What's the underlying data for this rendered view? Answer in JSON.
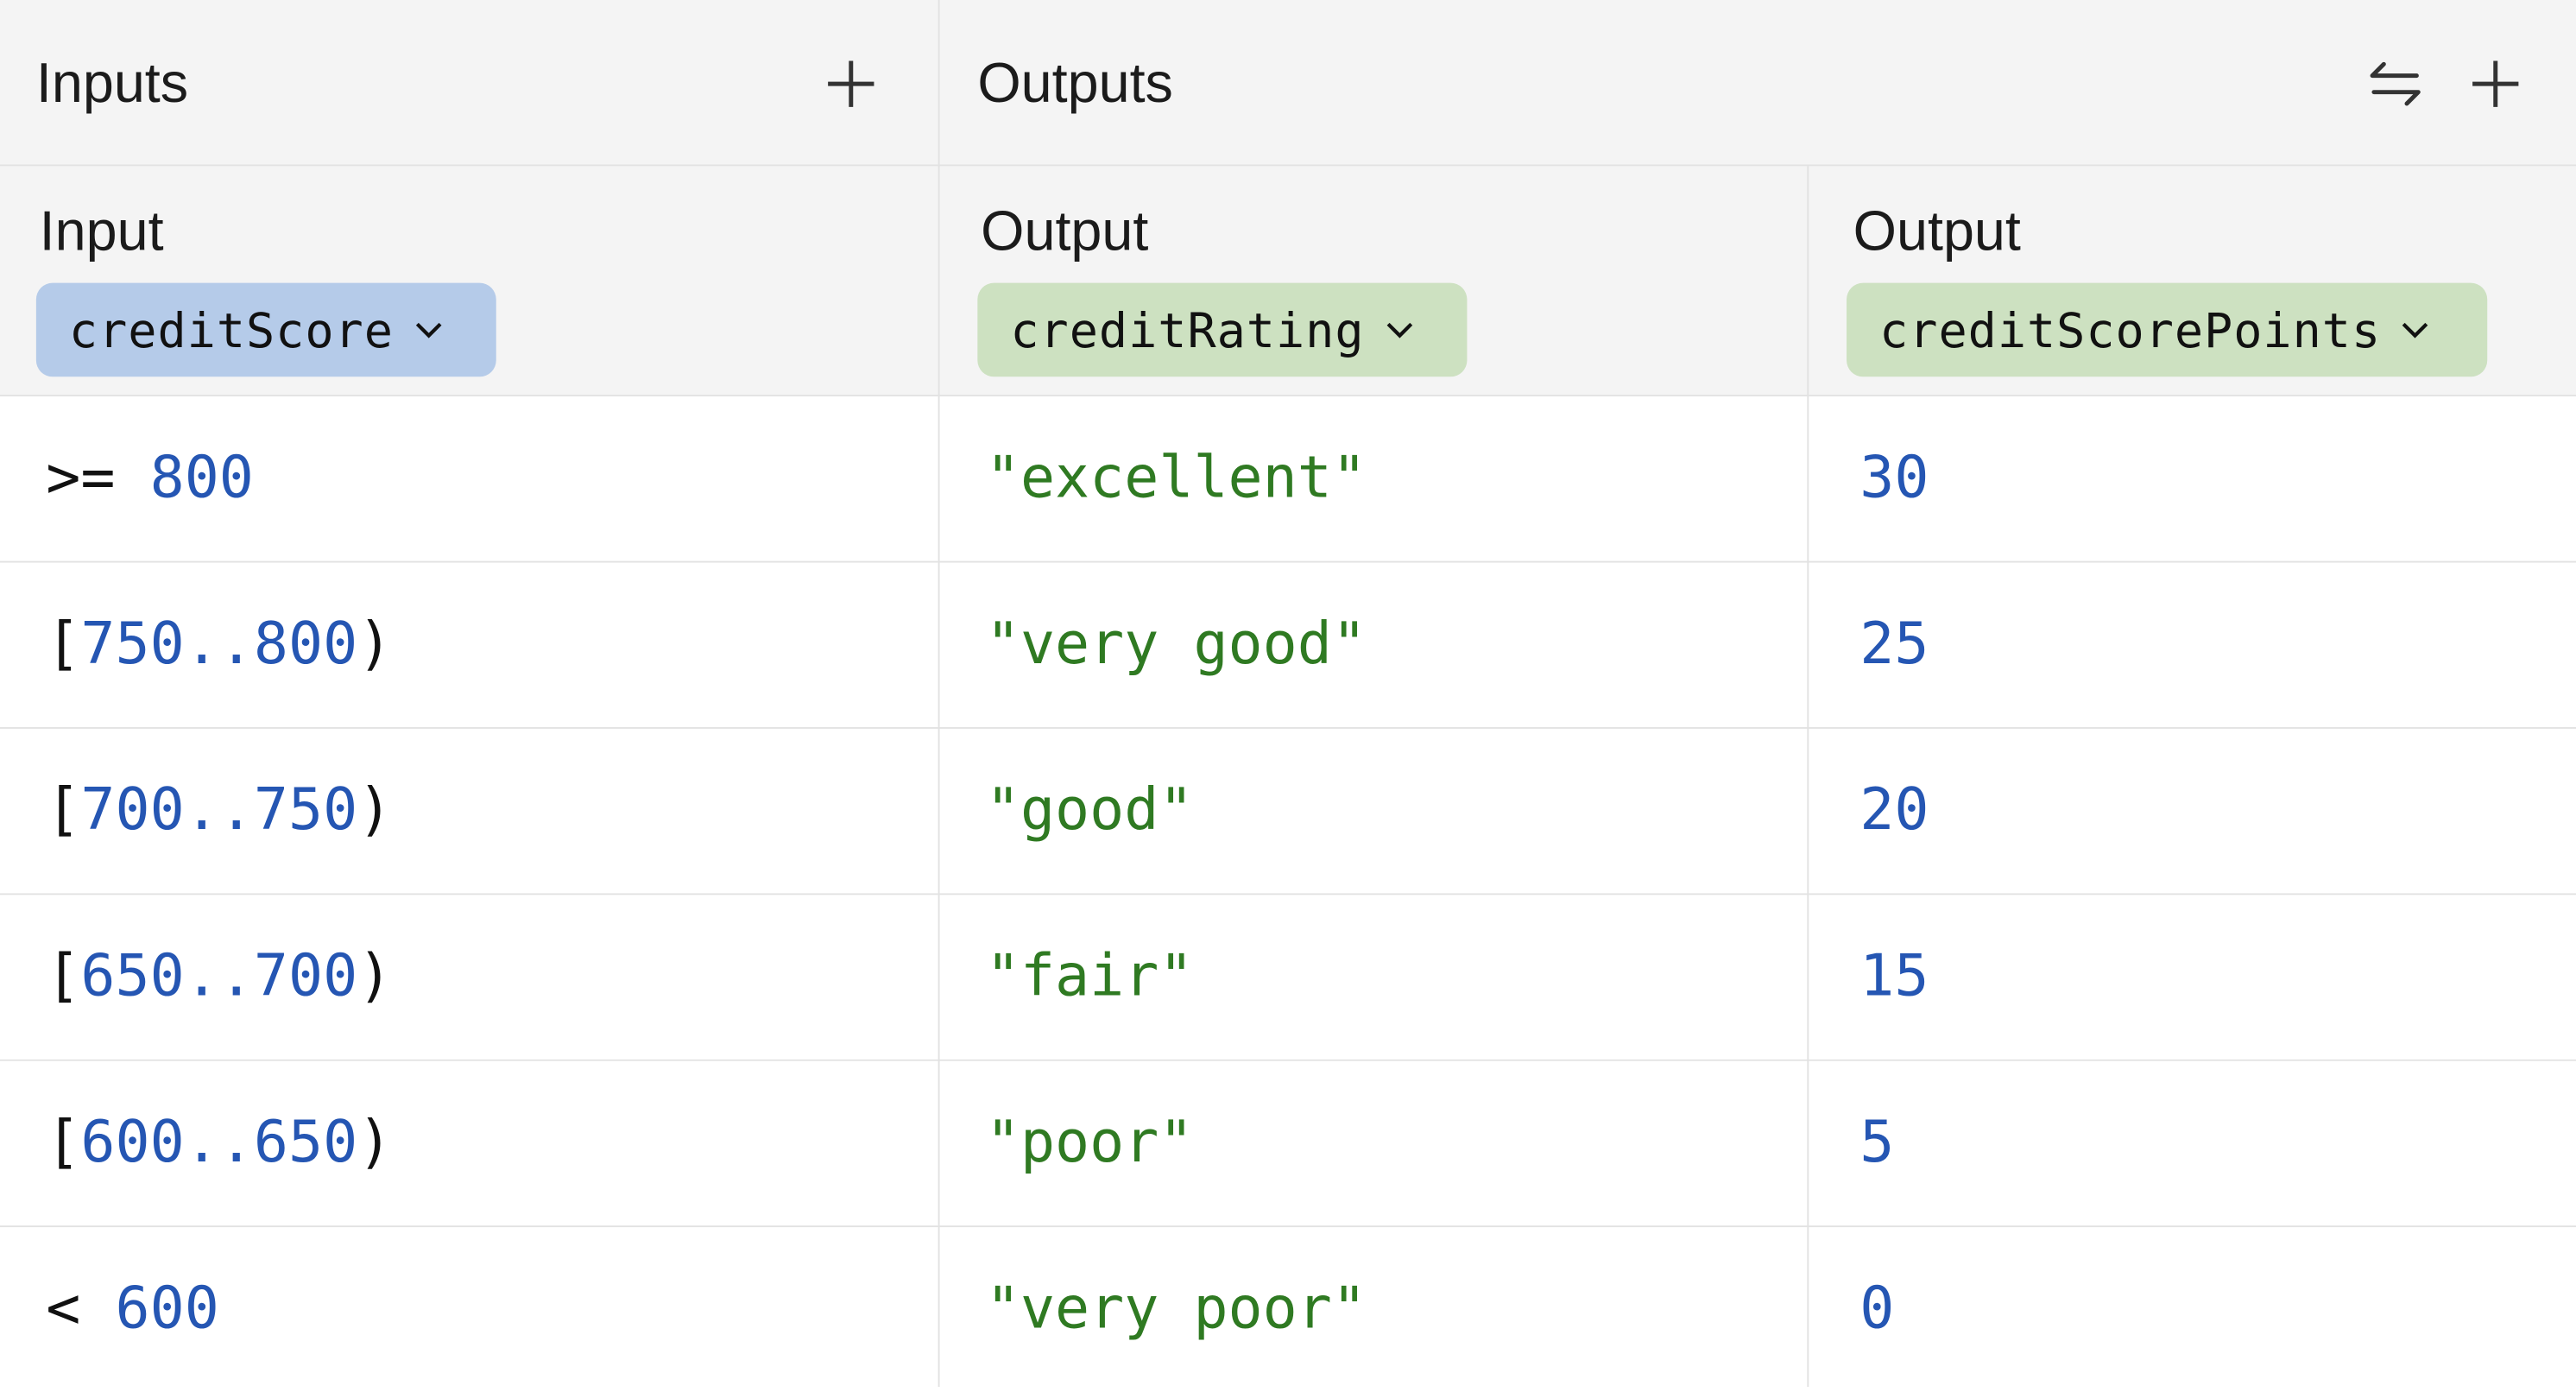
{
  "header": {
    "inputs_title": "Inputs",
    "outputs_title": "Outputs",
    "add_input_icon": "plus-icon",
    "swap_icon": "swap-arrows-icon",
    "add_output_icon": "plus-icon"
  },
  "columns": [
    {
      "kind": "input",
      "label": "Input",
      "name": "creditScore",
      "color": "#b5cbe9"
    },
    {
      "kind": "output",
      "label": "Output",
      "name": "creditRating",
      "color": "#cde1c1"
    },
    {
      "kind": "output",
      "label": "Output",
      "name": "creditScorePoints",
      "color": "#cde1c1"
    }
  ],
  "rows": [
    {
      "input": [
        ">= ",
        "800"
      ],
      "rating": "\"excellent\"",
      "points": "30"
    },
    {
      "input": [
        "[",
        "750..800",
        ")"
      ],
      "rating": "\"very good\"",
      "points": "25"
    },
    {
      "input": [
        "[",
        "700..750",
        ")"
      ],
      "rating": "\"good\"",
      "points": "20"
    },
    {
      "input": [
        "[",
        "650..700",
        ")"
      ],
      "rating": "\"fair\"",
      "points": "15"
    },
    {
      "input": [
        "[",
        "600..650",
        ")"
      ],
      "rating": "\"poor\"",
      "points": "5"
    },
    {
      "input": [
        "< ",
        "600"
      ],
      "rating": "\"very poor\"",
      "points": "0"
    }
  ],
  "colors": {
    "number": "#2556b3",
    "string": "#2f7a22",
    "header_bg": "#f4f4f4",
    "border": "#e2e2e2"
  }
}
